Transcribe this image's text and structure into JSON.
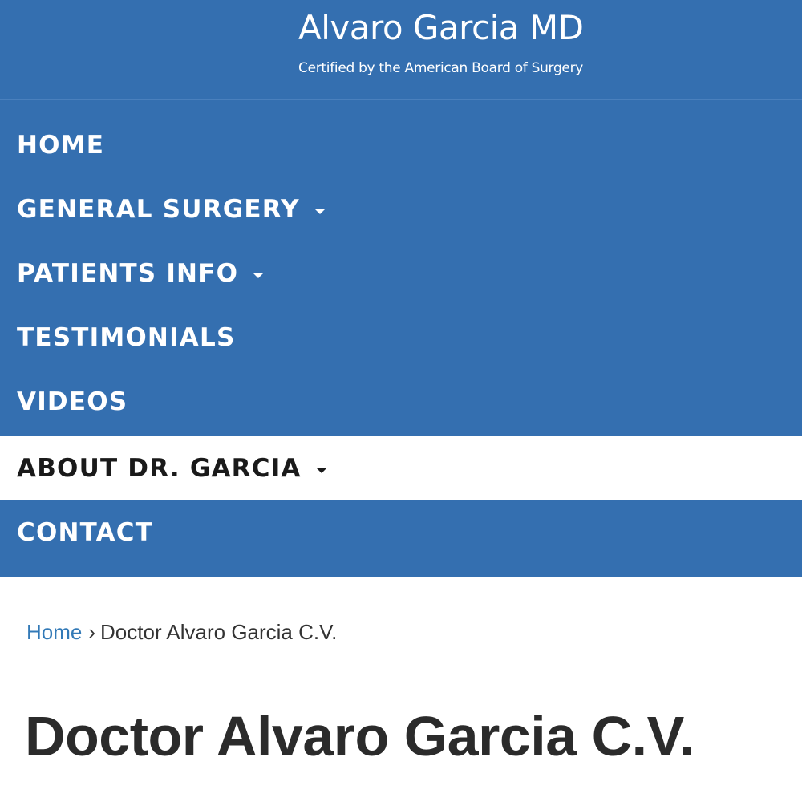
{
  "header": {
    "title": "Alvaro Garcia MD",
    "tagline": "Certified by the American Board of Surgery"
  },
  "nav": {
    "items": [
      {
        "label": "HOME",
        "has_dropdown": false,
        "active": false
      },
      {
        "label": "GENERAL SURGERY",
        "has_dropdown": true,
        "active": false
      },
      {
        "label": "PATIENTS INFO",
        "has_dropdown": true,
        "active": false
      },
      {
        "label": "TESTIMONIALS",
        "has_dropdown": false,
        "active": false
      },
      {
        "label": "VIDEOS",
        "has_dropdown": false,
        "active": false
      },
      {
        "label": "ABOUT DR. GARCIA",
        "has_dropdown": true,
        "active": true
      },
      {
        "label": "CONTACT",
        "has_dropdown": false,
        "active": false
      }
    ],
    "dropdown_icon": "caret-down-icon"
  },
  "breadcrumb": {
    "home_label": "Home",
    "separator": "›",
    "current": "Doctor Alvaro Garcia C.V."
  },
  "page": {
    "title": "Doctor Alvaro Garcia C.V."
  },
  "colors": {
    "brand_blue": "#346fb0",
    "link_blue": "#337ab7",
    "text_dark": "#2b2b2b",
    "background": "#ffffff"
  }
}
